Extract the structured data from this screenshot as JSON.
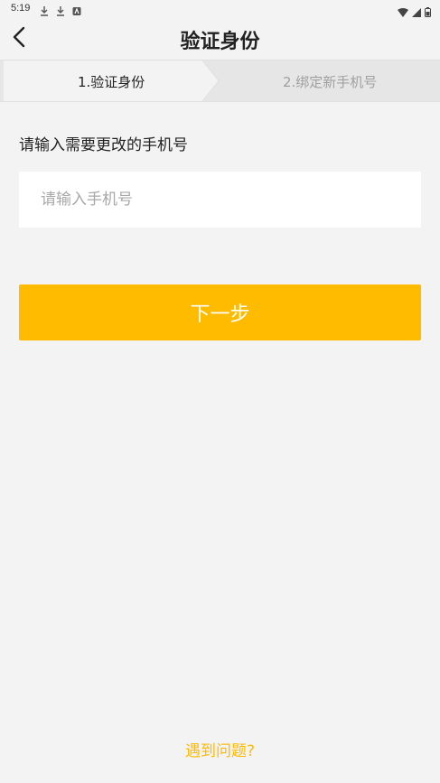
{
  "status_bar": {
    "time": "5:19",
    "left_icons": [
      "download-icon",
      "download-icon",
      "app-notification-icon"
    ],
    "right_icons": [
      "wifi-icon",
      "signal-icon",
      "battery-icon"
    ]
  },
  "header": {
    "back_icon": "chevron-left-icon",
    "title": "验证身份"
  },
  "steps": {
    "items": [
      {
        "label": "1.验证身份",
        "state": "active"
      },
      {
        "label": "2.绑定新手机号",
        "state": "inactive"
      }
    ]
  },
  "form": {
    "prompt": "请输入需要更改的手机号",
    "phone_value": "",
    "phone_placeholder": "请输入手机号",
    "next_label": "下一步"
  },
  "footer": {
    "help_label": "遇到问题?"
  },
  "colors": {
    "accent": "#ffbb00",
    "background": "#f3f3f3",
    "step_active_bg": "#f3f3f3",
    "step_inactive_bg": "#e6e6e6",
    "text_primary": "#222222",
    "text_muted": "#a0a0a0"
  }
}
